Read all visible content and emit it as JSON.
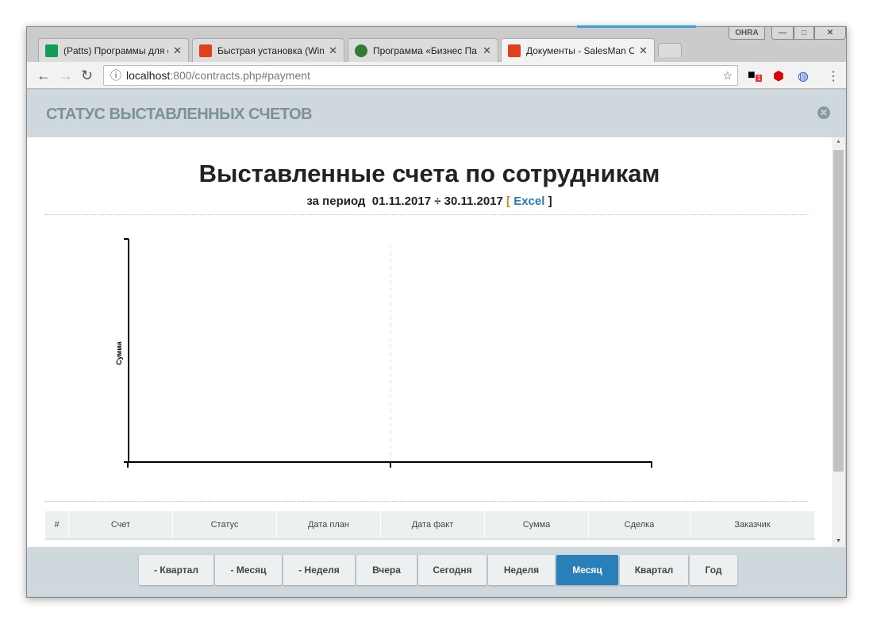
{
  "browser": {
    "profile": "OHRA",
    "tabs": [
      {
        "title": "(Patts) Программы для с",
        "icon": "google-sheets-icon",
        "color": "#0f9d58",
        "active": false
      },
      {
        "title": "Быстрая установка (Win",
        "icon": "salesman-icon",
        "color": "#e0401c",
        "active": false
      },
      {
        "title": "Программа «Бизнес Па",
        "icon": "green-logo-icon",
        "color": "#2e7d32",
        "active": false
      },
      {
        "title": "Документы - SalesMan С",
        "icon": "salesman-icon",
        "color": "#e0401c",
        "active": true
      }
    ],
    "url_host": "localhost",
    "url_rest": ":800/contracts.php#payment",
    "extension_badge": "1"
  },
  "header": {
    "title": "СТАТУС ВЫСТАВЛЕННЫХ СЧЕТОВ"
  },
  "report": {
    "title": "Выставленные счета по сотрудникам",
    "period_label": "за период",
    "period": "01.11.2017 ÷ 30.11.2017",
    "bracket_open": "[",
    "excel_link": "Excel",
    "bracket_close": "]"
  },
  "chart_data": {
    "type": "bar",
    "ylabel": "Сумма",
    "categories": [],
    "series": [],
    "grid": "vertical dashed center line"
  },
  "table": {
    "columns": [
      "#",
      "Счет",
      "Статус",
      "Дата план",
      "Дата факт",
      "Сумма",
      "Сделка",
      "Заказчик"
    ]
  },
  "footer": {
    "buttons": [
      {
        "label": "- Квартал",
        "active": false
      },
      {
        "label": "- Месяц",
        "active": false
      },
      {
        "label": "- Неделя",
        "active": false
      },
      {
        "label": "Вчера",
        "active": false
      },
      {
        "label": "Сегодня",
        "active": false
      },
      {
        "label": "Неделя",
        "active": false
      },
      {
        "label": "Месяц",
        "active": true
      },
      {
        "label": "Квартал",
        "active": false
      },
      {
        "label": "Год",
        "active": false
      }
    ],
    "accent": "#2980b9"
  }
}
